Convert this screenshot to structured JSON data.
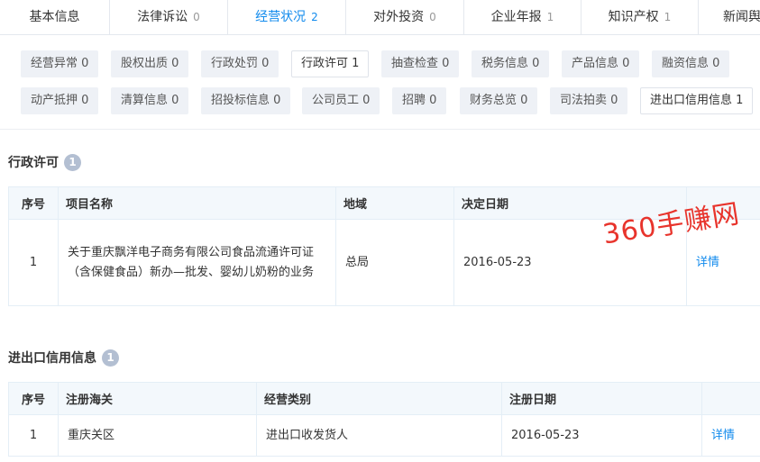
{
  "tabs": [
    {
      "label": "基本信息",
      "count": ""
    },
    {
      "label": "法律诉讼",
      "count": "0"
    },
    {
      "label": "经营状况",
      "count": "2"
    },
    {
      "label": "对外投资",
      "count": "0"
    },
    {
      "label": "企业年报",
      "count": "1"
    },
    {
      "label": "知识产权",
      "count": "1"
    },
    {
      "label": "新闻舆",
      "count": ""
    }
  ],
  "chips": [
    "经营异常 0",
    "股权出质 0",
    "行政处罚 0",
    "行政许可 1",
    "抽查检查 0",
    "税务信息 0",
    "产品信息 0",
    "融资信息 0",
    "动产抵押 0",
    "清算信息 0",
    "招投标信息 0",
    "公司员工 0",
    "招聘 0",
    "财务总览 0",
    "司法拍卖 0",
    "进出口信用信息 1"
  ],
  "permit": {
    "title": "行政许可",
    "badge": "1",
    "headers": [
      "序号",
      "项目名称",
      "地域",
      "决定日期",
      ""
    ],
    "rows": [
      {
        "idx": "1",
        "name": "关于重庆飘洋电子商务有限公司食品流通许可证（含保健食品）新办—批发、婴幼儿奶粉的业务",
        "region": "总局",
        "date": "2016-05-23",
        "action": "详情"
      }
    ]
  },
  "trade": {
    "title": "进出口信用信息",
    "badge": "1",
    "headers": [
      "序号",
      "注册海关",
      "经营类别",
      "注册日期",
      ""
    ],
    "rows": [
      {
        "idx": "1",
        "customs": "重庆关区",
        "category": "进出口收发货人",
        "date": "2016-05-23",
        "action": "详情"
      }
    ]
  },
  "watermark": "360手赚网"
}
